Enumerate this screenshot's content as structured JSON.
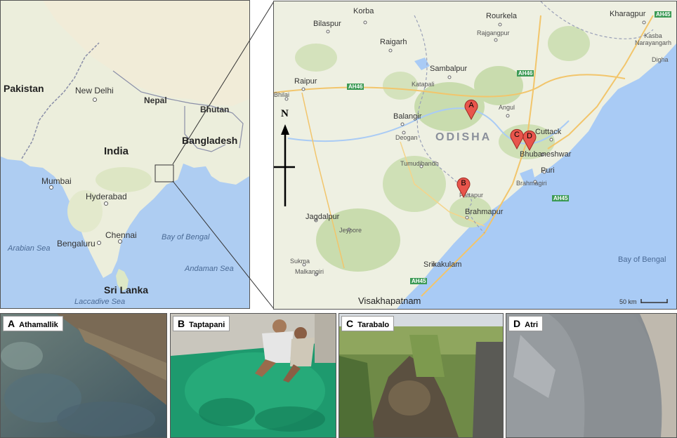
{
  "overview_map": {
    "countries": [
      "Pakistan",
      "India",
      "Nepal",
      "Bhutan",
      "Bangladesh",
      "Sri Lanka"
    ],
    "cities": [
      "New Delhi",
      "Mumbai",
      "Hyderabad",
      "Bengaluru",
      "Chennai"
    ],
    "seas": [
      "Arabian Sea",
      "Bay of Bengal",
      "Andaman Sea",
      "Laccadive Sea"
    ]
  },
  "detail_map": {
    "state": "ODISHA",
    "cities": [
      "Korba",
      "Rourkela",
      "Kharagpur",
      "Bilaspur",
      "Raigarh",
      "Rajgangpur",
      "Kasba Narayangarh",
      "Digha",
      "Raipur",
      "Bhilai",
      "Sambalpur",
      "Katapali",
      "Angul",
      "Balangir",
      "Deogan",
      "Cuttack",
      "Bhubaneshwar",
      "Tumudibandh",
      "Puri",
      "Brahmagiri",
      "Pattapur",
      "Brahmapur",
      "Jagdalpur",
      "Jeypore",
      "Sukma",
      "Malkangiri",
      "Srikakulam",
      "Visakhapatnam"
    ],
    "highways": [
      "AH45",
      "AH46",
      "AH46",
      "AH45",
      "AH45"
    ],
    "sea": "Bay of Bengal",
    "compass": "N",
    "scale": "50 km",
    "markers": [
      "A",
      "B",
      "C",
      "D"
    ]
  },
  "photos": [
    {
      "letter": "A",
      "name": "Athamallik"
    },
    {
      "letter": "B",
      "name": "Taptapani"
    },
    {
      "letter": "C",
      "name": "Tarabalo"
    },
    {
      "letter": "D",
      "name": "Atri"
    }
  ],
  "colors": {
    "sea": "#a9cbf5",
    "land": "#eef0e2",
    "forest": "#c6dba8",
    "marker": "#e8554c",
    "road": "#f2c56b"
  }
}
